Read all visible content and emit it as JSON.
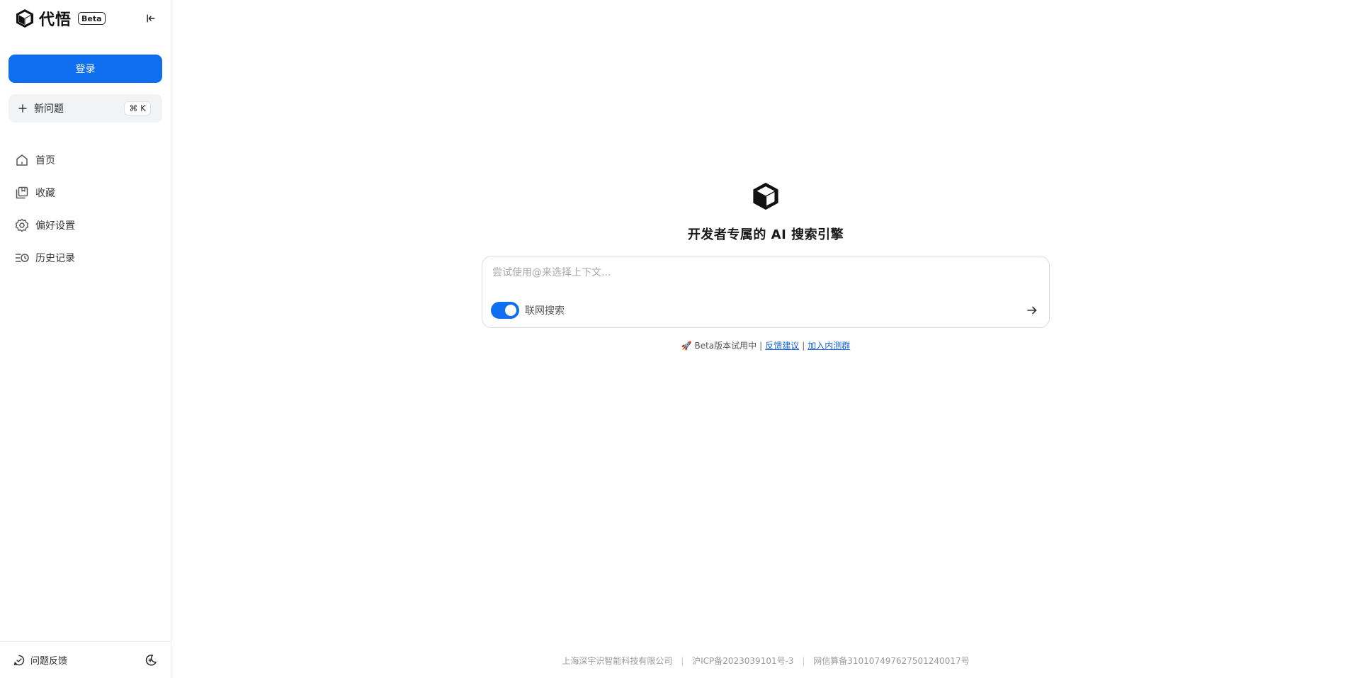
{
  "brand": {
    "name": "代悟",
    "badge": "Beta"
  },
  "sidebar": {
    "login_label": "登录",
    "new_question": {
      "label": "新问题",
      "shortcut": "⌘ K"
    },
    "nav": [
      {
        "label": "首页",
        "icon": "home-icon"
      },
      {
        "label": "收藏",
        "icon": "bookmark-icon"
      },
      {
        "label": "偏好设置",
        "icon": "gear-icon"
      },
      {
        "label": "历史记录",
        "icon": "history-icon"
      }
    ],
    "footer": {
      "feedback_label": "问题反馈"
    }
  },
  "main": {
    "headline": "开发者专属的 AI 搜索引擎",
    "search": {
      "placeholder": "尝试使用@来选择上下文...",
      "value": ""
    },
    "web_search_label": "联网搜索",
    "web_search_on": true,
    "beta_note": {
      "text": "🚀 Beta版本试用中",
      "sep": "|",
      "link1": "反馈建议",
      "link2": "加入内测群"
    }
  },
  "footer": {
    "company": "上海深宇识智能科技有限公司",
    "icp": "沪ICP备2023039101号-3",
    "gongan": "网信算备310107497627501240017号",
    "sep": "|"
  },
  "colors": {
    "accent": "#0f6ef0",
    "link": "#1b62d6"
  }
}
